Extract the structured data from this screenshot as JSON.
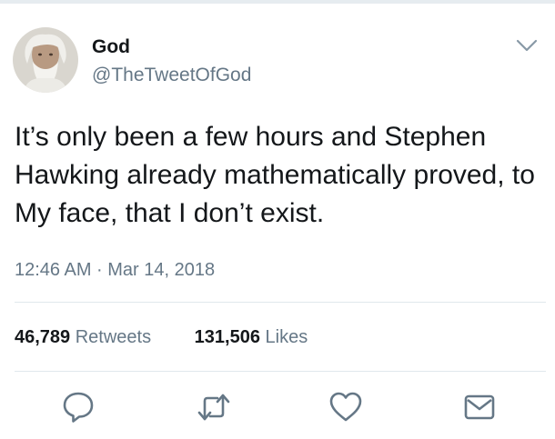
{
  "tweet": {
    "author_name": "God",
    "handle": "@TheTweetOfGod",
    "text": "It’s only been a few hours and Stephen Hawking already mathematically proved, to My face, that I don’t exist.",
    "timestamp": "12:46 AM · Mar 14, 2018"
  },
  "stats": {
    "retweets_count": "46,789",
    "retweets_label": "Retweets",
    "likes_count": "131,506",
    "likes_label": "Likes"
  },
  "icons": {
    "more": "chevron-down-icon",
    "reply": "reply-icon",
    "retweet": "retweet-icon",
    "like": "heart-icon",
    "message": "envelope-icon"
  },
  "colors": {
    "text": "#14171a",
    "secondary": "#657786",
    "divider": "#e1e8ed"
  }
}
